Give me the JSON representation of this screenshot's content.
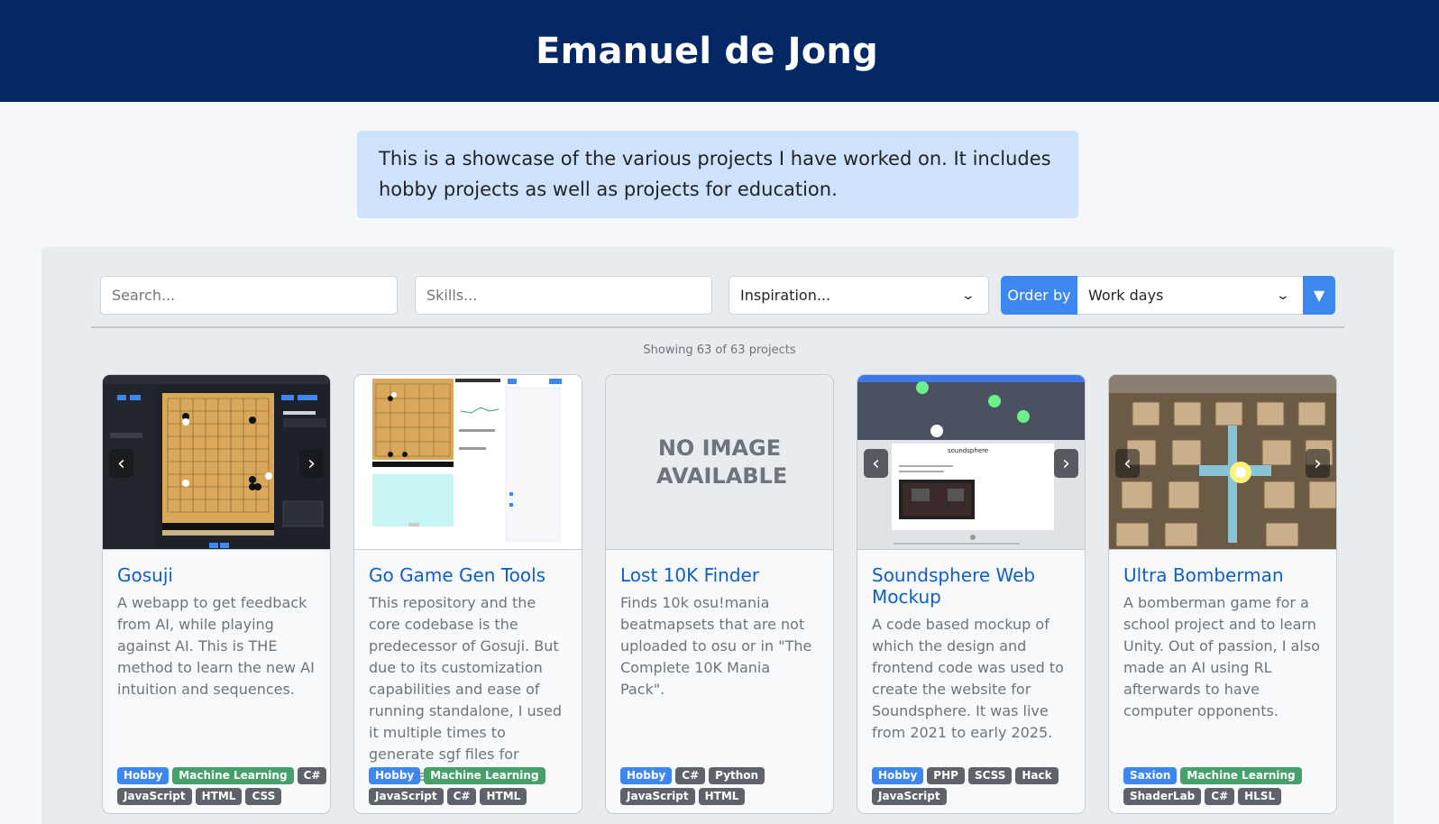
{
  "header": {
    "title": "Emanuel de Jong"
  },
  "intro": {
    "text": "This is a showcase of the various projects I have worked on. It includes hobby projects as well as projects for education."
  },
  "filters": {
    "search_placeholder": "Search...",
    "skills_placeholder": "Skills...",
    "inspiration_value": "Inspiration...",
    "order_label": "Order by",
    "order_value": "Work days",
    "order_direction_icon": "▼"
  },
  "count_text": "Showing 63 of 63 projects",
  "colors": {
    "header": "#042766",
    "intro_bg": "#cfe2fc",
    "accent": "#3c88f0",
    "tag_green": "#46a06a",
    "tag_grey": "#5c636a"
  },
  "cards": [
    {
      "title": "Gosuji",
      "desc": "A webapp to get feedback from AI, while playing against AI. This is THE method to learn the new AI intuition and sequences.",
      "thumb": "go-board-dark-screenshot",
      "has_nav": true,
      "tags": [
        {
          "label": "Hobby",
          "color": "blue"
        },
        {
          "label": "Machine Learning",
          "color": "green"
        },
        {
          "label": "C#",
          "color": "grey"
        },
        {
          "label": "JavaScript",
          "color": "grey"
        },
        {
          "label": "HTML",
          "color": "grey"
        },
        {
          "label": "CSS",
          "color": "grey"
        }
      ]
    },
    {
      "title": "Go Game Gen Tools",
      "desc": "This repository and the core codebase is the predecessor of Gosuji. But due to its customization capabilities and ease of running standalone, I used it multiple times to generate sgf files for personal data analysis.",
      "thumb": "go-board-light-screenshot",
      "has_nav": false,
      "tags": [
        {
          "label": "Hobby",
          "color": "blue"
        },
        {
          "label": "Machine Learning",
          "color": "green"
        },
        {
          "label": "JavaScript",
          "color": "grey"
        },
        {
          "label": "C#",
          "color": "grey"
        },
        {
          "label": "HTML",
          "color": "grey"
        }
      ]
    },
    {
      "title": "Lost 10K Finder",
      "desc": "Finds 10k osu!mania beatmapsets that are not uploaded to osu or in \"The Complete 10K Mania Pack\".",
      "thumb": "no-image",
      "noimg_text": "NO IMAGE AVAILABLE",
      "has_nav": false,
      "tags": [
        {
          "label": "Hobby",
          "color": "blue"
        },
        {
          "label": "C#",
          "color": "grey"
        },
        {
          "label": "Python",
          "color": "grey"
        },
        {
          "label": "JavaScript",
          "color": "grey"
        },
        {
          "label": "HTML",
          "color": "grey"
        }
      ]
    },
    {
      "title": "Soundsphere Web Mockup",
      "desc": "A code based mockup of which the design and frontend code was used to create the website for Soundsphere. It was live from 2021 to early 2025.",
      "thumb": "soundsphere-website-screenshot",
      "thumb_text": "soundsphere",
      "has_nav": true,
      "tags": [
        {
          "label": "Hobby",
          "color": "blue"
        },
        {
          "label": "PHP",
          "color": "grey"
        },
        {
          "label": "SCSS",
          "color": "grey"
        },
        {
          "label": "Hack",
          "color": "grey"
        },
        {
          "label": "JavaScript",
          "color": "grey"
        }
      ]
    },
    {
      "title": "Ultra Bomberman",
      "desc": "A bomberman game for a school project and to learn Unity. Out of passion, I also made an AI using RL afterwards to have computer opponents.",
      "thumb": "bomberman-game-screenshot",
      "has_nav": true,
      "tags": [
        {
          "label": "Saxion",
          "color": "blue"
        },
        {
          "label": "Machine Learning",
          "color": "green"
        },
        {
          "label": "ShaderLab",
          "color": "grey"
        },
        {
          "label": "C#",
          "color": "grey"
        },
        {
          "label": "HLSL",
          "color": "grey"
        }
      ]
    }
  ]
}
